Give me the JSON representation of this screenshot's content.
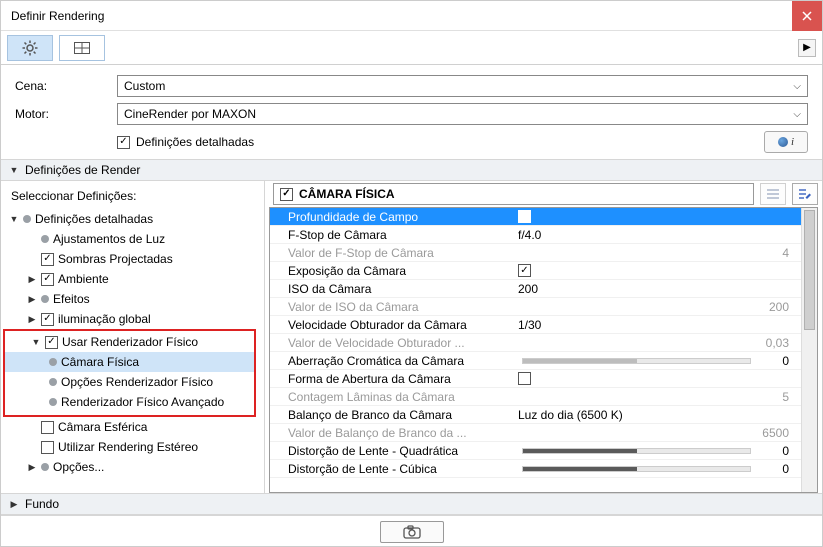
{
  "window": {
    "title": "Definir Rendering"
  },
  "form": {
    "scene_label": "Cena:",
    "scene_value": "Custom",
    "engine_label": "Motor:",
    "engine_value": "CineRender por MAXON",
    "detailed_label": "Definições detalhadas"
  },
  "sections": {
    "render_defs": "Definições de Render",
    "select_defs": "Seleccionar Definições:",
    "fundo": "Fundo"
  },
  "tree": {
    "root": "Definições detalhadas",
    "light_adj": "Ajustamentos de Luz",
    "shadows": "Sombras Projectadas",
    "ambient": "Ambiente",
    "effects": "Efeitos",
    "gi": "iluminação global",
    "use_phys": "Usar Renderizador Físico",
    "cam_phys": "Câmara Física",
    "phys_opts": "Opções Renderizador Físico",
    "phys_adv": "Renderizador Físico Avançado",
    "sph_cam": "Câmara Esférica",
    "stereo": "Utilizar Rendering Estéreo",
    "options": "Opções..."
  },
  "panel": {
    "title": "CÂMARA FÍSICA"
  },
  "props": {
    "dof": "Profundidade de Campo",
    "fstop": {
      "label": "F-Stop de Câmara",
      "value": "f/4.0"
    },
    "fstop_val": {
      "label": "Valor de F-Stop de Câmara",
      "value": "4"
    },
    "expo": "Exposição da Câmara",
    "iso": {
      "label": "ISO da Câmara",
      "value": "200"
    },
    "iso_val": {
      "label": "Valor de ISO da Câmara",
      "value": "200"
    },
    "shutter": {
      "label": "Velocidade Obturador da Câmara",
      "value": "1/30"
    },
    "shutter_val": {
      "label": "Valor de Velocidade Obturador ...",
      "value": "0,03"
    },
    "chrom": {
      "label": "Aberração Cromática da Câmara",
      "value": "0"
    },
    "aperture_shape": "Forma de Abertura da Câmara",
    "blades": {
      "label": "Contagem Lâminas da Câmara",
      "value": "5"
    },
    "wb": {
      "label": "Balanço de Branco da Câmara",
      "value": "Luz do dia (6500 K)"
    },
    "wb_val": {
      "label": "Valor de Balanço de Branco da ...",
      "value": "6500"
    },
    "dist_q": {
      "label": "Distorção de Lente - Quadrática",
      "value": "0"
    },
    "dist_c": {
      "label": "Distorção de Lente - Cúbica",
      "value": "0"
    }
  }
}
